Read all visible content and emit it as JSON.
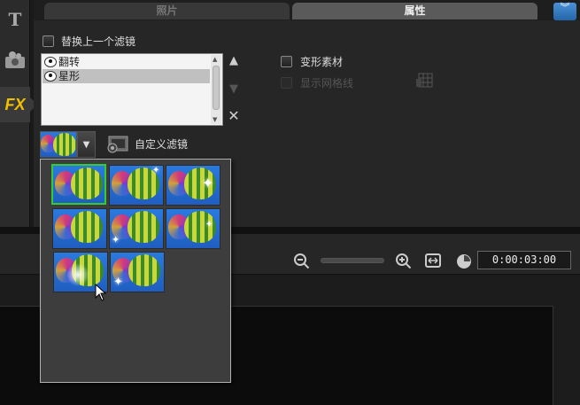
{
  "tabs": {
    "photo": "照片",
    "attributes": "属性"
  },
  "options": {
    "replace_last_filter": "替换上一个滤镜",
    "morph_clip": "变形素材",
    "show_grid_lines": "显示网格线",
    "custom_filter": "自定义滤镜"
  },
  "filter_list": [
    {
      "name": "翻转"
    },
    {
      "name": "星形"
    }
  ],
  "preset_gallery": {
    "count": 8,
    "selected_index": 0
  },
  "timeline": {
    "timecode": "0:00:03:00"
  },
  "colors": {
    "accent": "#33cc33",
    "fx_icon": "#f0c000",
    "header_button": "#3a7fc8"
  },
  "icons": [
    "title-icon",
    "graphics-icon",
    "fx-icon",
    "grid-options-icon",
    "custom-filter-icon",
    "zoom-out-icon",
    "zoom-in-icon",
    "fit-project-icon",
    "clock-icon",
    "eye-icon",
    "sparkle-icon"
  ]
}
